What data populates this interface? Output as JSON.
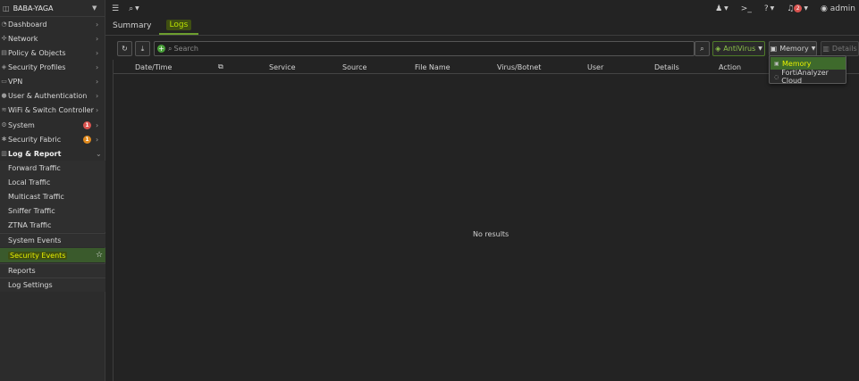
{
  "sidebar": {
    "title": "BABA-YAGA",
    "items": [
      {
        "label": "Dashboard"
      },
      {
        "label": "Network"
      },
      {
        "label": "Policy & Objects"
      },
      {
        "label": "Security Profiles"
      },
      {
        "label": "VPN"
      },
      {
        "label": "User & Authentication"
      },
      {
        "label": "WiFi & Switch Controller"
      },
      {
        "label": "System",
        "badge": "1"
      },
      {
        "label": "Security Fabric",
        "badge": "1"
      },
      {
        "label": "Log & Report"
      }
    ],
    "subitems": [
      {
        "label": "Forward Traffic"
      },
      {
        "label": "Local Traffic"
      },
      {
        "label": "Multicast Traffic"
      },
      {
        "label": "Sniffer Traffic"
      },
      {
        "label": "ZTNA Traffic"
      },
      {
        "label": "System Events"
      },
      {
        "label": "Security Events"
      },
      {
        "label": "Reports"
      },
      {
        "label": "Log Settings"
      }
    ]
  },
  "topbar": {
    "notifications": "2",
    "user": "admin"
  },
  "tabs": [
    {
      "label": "Summary"
    },
    {
      "label": "Logs"
    }
  ],
  "toolbar": {
    "search_placeholder": "Search",
    "filter_label": "AntiVirus",
    "source_label": "Memory",
    "details_label": "Details"
  },
  "table": {
    "columns": [
      "Date/Time",
      "Service",
      "Source",
      "File Name",
      "Virus/Botnet",
      "User",
      "Details",
      "Action"
    ],
    "empty_text": "No results"
  },
  "dropdown": {
    "items": [
      {
        "label": "Memory"
      },
      {
        "label": "FortiAnalyzer Cloud"
      }
    ]
  },
  "colors": {
    "accent": "#6d9e2f",
    "highlight_text": "#e6f000",
    "badge_red": "#d9534f",
    "badge_orange": "#e08a1e"
  }
}
